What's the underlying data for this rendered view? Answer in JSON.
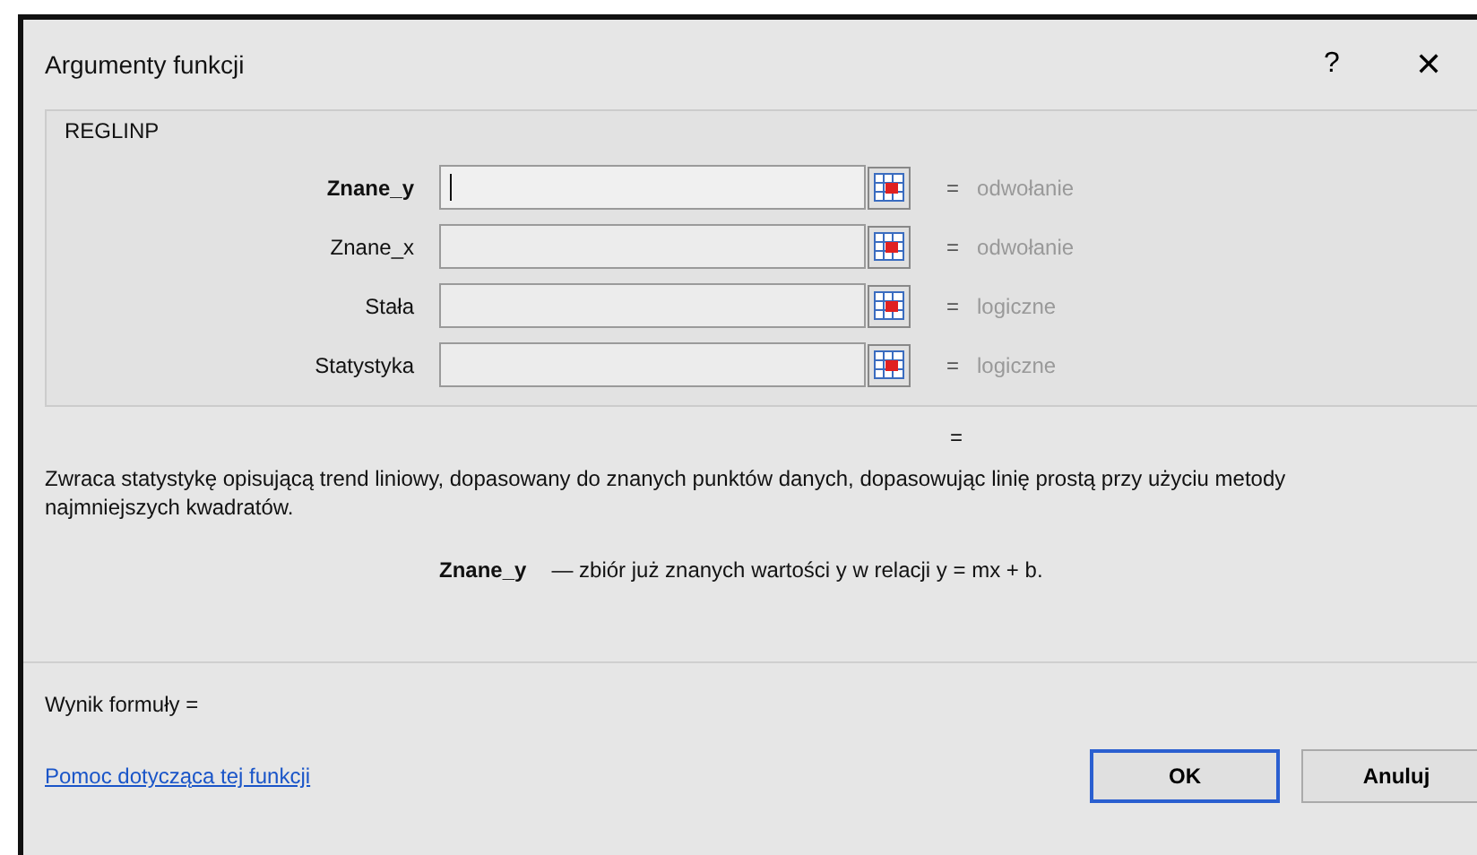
{
  "window": {
    "title": "Argumenty funkcji",
    "help": "?",
    "close": "✕"
  },
  "function_group": {
    "name": "REGLINP",
    "arguments": [
      {
        "label": "Znane_y",
        "selected": true,
        "equals": "=",
        "hint": "odwołanie"
      },
      {
        "label": "Znane_x",
        "selected": false,
        "equals": "=",
        "hint": "odwołanie"
      },
      {
        "label": "Stała",
        "selected": false,
        "equals": "=",
        "hint": "logiczne"
      },
      {
        "label": "Statystyka",
        "selected": false,
        "equals": "=",
        "hint": "logiczne"
      }
    ]
  },
  "result_equals": "=",
  "description": "Zwraca statystykę opisującą trend liniowy, dopasowany do znanych punktów danych, dopasowując linię prostą przy użyciu metody najmniejszych kwadratów.",
  "argument_help": {
    "name": "Znane_y",
    "text": "— zbiór już znanych wartości y w relacji y = mx + b."
  },
  "formula_result": "Wynik formuły =",
  "help_link": "Pomoc dotycząca tej funkcji",
  "buttons": [
    {
      "label": "OK",
      "default": true
    },
    {
      "label": "Anuluj",
      "default": false
    }
  ]
}
